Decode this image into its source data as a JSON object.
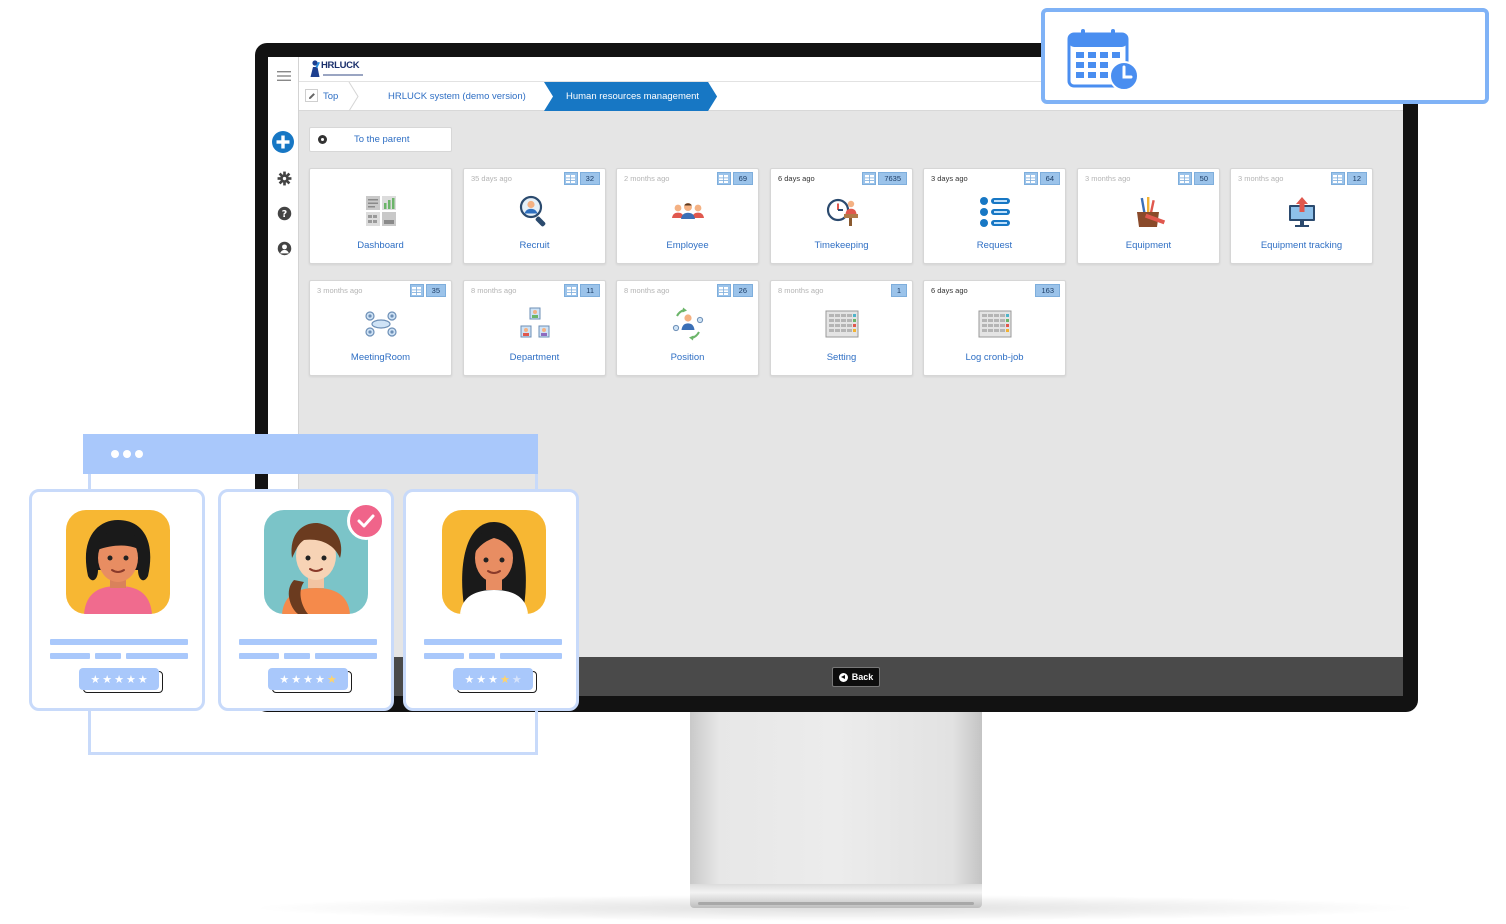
{
  "app": {
    "logo_text": "HRLUCK",
    "breadcrumb": [
      {
        "label": "Top"
      },
      {
        "label": "HRLUCK system (demo version)"
      },
      {
        "label": "Human resources management"
      }
    ],
    "parent_button": "To the parent",
    "back_button": "Back",
    "accent_color": "#1777c4",
    "tiles": [
      {
        "label": "Dashboard",
        "time": "",
        "count": "",
        "icon": "dashboard-icon"
      },
      {
        "label": "Recruit",
        "time": "35 days ago",
        "count": "32",
        "icon": "recruit-icon"
      },
      {
        "label": "Employee",
        "time": "2 months ago",
        "count": "69",
        "icon": "employee-icon"
      },
      {
        "label": "Timekeeping",
        "time": "6 days ago",
        "count": "7635",
        "icon": "timekeeping-icon"
      },
      {
        "label": "Request",
        "time": "3 days ago",
        "count": "64",
        "icon": "request-icon"
      },
      {
        "label": "Equipment",
        "time": "3 months ago",
        "count": "50",
        "icon": "equipment-icon"
      },
      {
        "label": "Equipment tracking",
        "time": "3 months ago",
        "count": "12",
        "icon": "equipment-tracking-icon"
      },
      {
        "label": "MeetingRoom",
        "time": "3 months ago",
        "count": "35",
        "icon": "meeting-room-icon"
      },
      {
        "label": "Department",
        "time": "8 months ago",
        "count": "11",
        "icon": "department-icon"
      },
      {
        "label": "Position",
        "time": "8 months ago",
        "count": "26",
        "icon": "position-icon"
      },
      {
        "label": "Setting",
        "time": "8 months ago",
        "count": "1",
        "icon": "setting-icon"
      },
      {
        "label": "Log cronb-job",
        "time": "6 days ago",
        "count": "163",
        "icon": "log-icon"
      }
    ]
  },
  "decor": {
    "calendar_icon": "calendar-clock-icon",
    "profiles": [
      {
        "avatar": "woman-short-hair-avatar",
        "rating": 5,
        "selected": false
      },
      {
        "avatar": "woman-ponytail-avatar",
        "rating": 4,
        "selected": true
      },
      {
        "avatar": "woman-long-hair-avatar",
        "rating": 3,
        "selected": false
      }
    ],
    "overlay_color": "#a9c8fb",
    "check_color": "#f0648a"
  }
}
